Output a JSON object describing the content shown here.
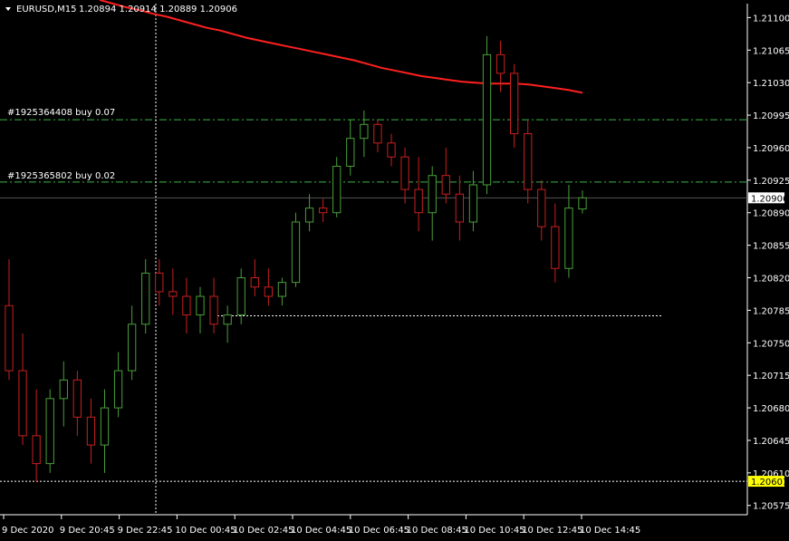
{
  "header": {
    "symbol": "EURUSD,M15",
    "ohlc": "1.20894 1.20914 1.20889 1.20906"
  },
  "orders": [
    {
      "label": "#1925364408 buy 0.07",
      "price": 1.2099
    },
    {
      "label": "#1925365802 buy 0.02",
      "price": 1.20923
    }
  ],
  "chart_data": {
    "type": "candlestick",
    "ylim": [
      1.20565,
      1.21115
    ],
    "yticks": [
      "1.21100",
      "1.21065",
      "1.21030",
      "1.20995",
      "1.20960",
      "1.20925",
      "1.20890",
      "1.20855",
      "1.20820",
      "1.20785",
      "1.20750",
      "1.20715",
      "1.20680",
      "1.20645",
      "1.20610",
      "1.20575"
    ],
    "xticks": [
      "9 Dec 2020",
      "9 Dec 20:45",
      "9 Dec 22:45",
      "10 Dec 00:45",
      "10 Dec 02:45",
      "10 Dec 04:45",
      "10 Dec 06:45",
      "10 Dec 08:45",
      "10 Dec 10:45",
      "10 Dec 12:45",
      "10 Dec 14:45"
    ],
    "bid_price": "1.20906",
    "ask_line_price": "1.20601",
    "ask_line_value": 1.20601,
    "support_line_value": 1.20779,
    "crosshair_price": 1.20601,
    "colors": {
      "bull": "#4a9e3a",
      "bear": "#c82020",
      "ma": "#ff2020",
      "order": "#3cb34a",
      "grid": "#2a2a2a",
      "axis": "#ffffff"
    },
    "moving_average": [
      1.21119,
      1.21115,
      1.21111,
      1.21108,
      1.21104,
      1.21101,
      1.21097,
      1.21093,
      1.21089,
      1.21086,
      1.21082,
      1.21078,
      1.21075,
      1.21072,
      1.21069,
      1.21066,
      1.21063,
      1.2106,
      1.21057,
      1.21054,
      1.2105,
      1.21046,
      1.21043,
      1.2104,
      1.21037,
      1.21035,
      1.21033,
      1.21031,
      1.2103,
      1.21029,
      1.21029,
      1.21029,
      1.21028,
      1.21026,
      1.21024,
      1.21022,
      1.21019
    ],
    "candles": [
      {
        "o": 1.2079,
        "h": 1.2084,
        "l": 1.2071,
        "c": 1.2072
      },
      {
        "o": 1.2072,
        "h": 1.2076,
        "l": 1.2064,
        "c": 1.2065
      },
      {
        "o": 1.2065,
        "h": 1.207,
        "l": 1.206,
        "c": 1.2062
      },
      {
        "o": 1.2062,
        "h": 1.207,
        "l": 1.2061,
        "c": 1.2069
      },
      {
        "o": 1.2069,
        "h": 1.2073,
        "l": 1.2066,
        "c": 1.2071
      },
      {
        "o": 1.2071,
        "h": 1.2072,
        "l": 1.2065,
        "c": 1.2067
      },
      {
        "o": 1.2067,
        "h": 1.2069,
        "l": 1.2062,
        "c": 1.2064
      },
      {
        "o": 1.2064,
        "h": 1.207,
        "l": 1.2061,
        "c": 1.2068
      },
      {
        "o": 1.2068,
        "h": 1.2074,
        "l": 1.2067,
        "c": 1.2072
      },
      {
        "o": 1.2072,
        "h": 1.2079,
        "l": 1.2071,
        "c": 1.2077
      },
      {
        "o": 1.2077,
        "h": 1.2084,
        "l": 1.2076,
        "c": 1.20825
      },
      {
        "o": 1.20825,
        "h": 1.2084,
        "l": 1.2079,
        "c": 1.20805
      },
      {
        "o": 1.20805,
        "h": 1.2083,
        "l": 1.2078,
        "c": 1.208
      },
      {
        "o": 1.208,
        "h": 1.2082,
        "l": 1.2076,
        "c": 1.2078
      },
      {
        "o": 1.2078,
        "h": 1.2081,
        "l": 1.2076,
        "c": 1.208
      },
      {
        "o": 1.208,
        "h": 1.2082,
        "l": 1.2076,
        "c": 1.2077
      },
      {
        "o": 1.2077,
        "h": 1.2079,
        "l": 1.2075,
        "c": 1.2078
      },
      {
        "o": 1.2078,
        "h": 1.2083,
        "l": 1.2077,
        "c": 1.2082
      },
      {
        "o": 1.2082,
        "h": 1.2084,
        "l": 1.208,
        "c": 1.2081
      },
      {
        "o": 1.2081,
        "h": 1.2083,
        "l": 1.2079,
        "c": 1.208
      },
      {
        "o": 1.208,
        "h": 1.2082,
        "l": 1.2079,
        "c": 1.20815
      },
      {
        "o": 1.20815,
        "h": 1.2089,
        "l": 1.2081,
        "c": 1.2088
      },
      {
        "o": 1.2088,
        "h": 1.2091,
        "l": 1.2087,
        "c": 1.20895
      },
      {
        "o": 1.20895,
        "h": 1.20905,
        "l": 1.2088,
        "c": 1.2089
      },
      {
        "o": 1.2089,
        "h": 1.2095,
        "l": 1.20885,
        "c": 1.2094
      },
      {
        "o": 1.2094,
        "h": 1.2099,
        "l": 1.2093,
        "c": 1.2097
      },
      {
        "o": 1.2097,
        "h": 1.21,
        "l": 1.2095,
        "c": 1.20985
      },
      {
        "o": 1.20985,
        "h": 1.2099,
        "l": 1.20955,
        "c": 1.20965
      },
      {
        "o": 1.20965,
        "h": 1.20975,
        "l": 1.2094,
        "c": 1.2095
      },
      {
        "o": 1.2095,
        "h": 1.2096,
        "l": 1.209,
        "c": 1.20915
      },
      {
        "o": 1.20915,
        "h": 1.2095,
        "l": 1.2087,
        "c": 1.2089
      },
      {
        "o": 1.2089,
        "h": 1.2094,
        "l": 1.2086,
        "c": 1.2093
      },
      {
        "o": 1.2093,
        "h": 1.2096,
        "l": 1.209,
        "c": 1.2091
      },
      {
        "o": 1.2091,
        "h": 1.2093,
        "l": 1.2086,
        "c": 1.2088
      },
      {
        "o": 1.2088,
        "h": 1.20935,
        "l": 1.2087,
        "c": 1.2092
      },
      {
        "o": 1.2092,
        "h": 1.2108,
        "l": 1.2091,
        "c": 1.2106
      },
      {
        "o": 1.2106,
        "h": 1.21075,
        "l": 1.2102,
        "c": 1.2104
      },
      {
        "o": 1.2104,
        "h": 1.2105,
        "l": 1.2096,
        "c": 1.20975
      },
      {
        "o": 1.20975,
        "h": 1.2099,
        "l": 1.209,
        "c": 1.20915
      },
      {
        "o": 1.20915,
        "h": 1.20925,
        "l": 1.2086,
        "c": 1.20875
      },
      {
        "o": 1.20875,
        "h": 1.209,
        "l": 1.20815,
        "c": 1.2083
      },
      {
        "o": 1.2083,
        "h": 1.2092,
        "l": 1.2082,
        "c": 1.20895
      },
      {
        "o": 1.20894,
        "h": 1.20914,
        "l": 1.20889,
        "c": 1.20906
      }
    ]
  }
}
